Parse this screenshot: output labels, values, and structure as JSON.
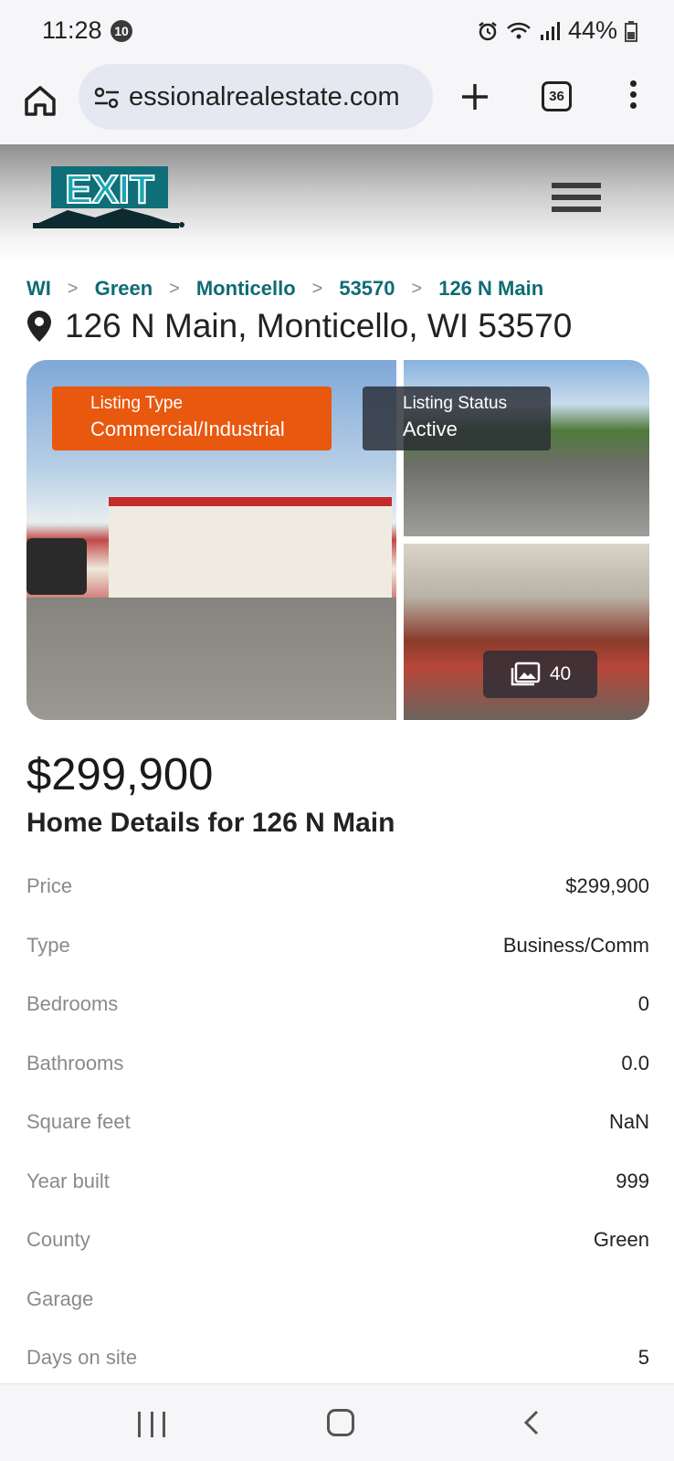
{
  "status_bar": {
    "time": "11:28",
    "notification_count": "10",
    "battery": "44%",
    "icons": [
      "alarm-icon",
      "wifi-icon",
      "signal-icon",
      "battery-icon"
    ]
  },
  "browser": {
    "url": "essionalrealestate.com",
    "tab_count": "36",
    "icons": [
      "home-icon",
      "site-settings-icon",
      "new-tab-icon",
      "tabs-icon",
      "more-icon"
    ]
  },
  "site": {
    "logo_text": "EXIT",
    "menu_icon": "hamburger-menu-icon"
  },
  "breadcrumb": [
    "WI",
    "Green",
    "Monticello",
    "53570",
    "126 N Main"
  ],
  "address": "126 N Main, Monticello, WI 53570",
  "gallery": {
    "listing_type_label": "Listing Type",
    "listing_type_value": "Commercial/Industrial",
    "listing_status_label": "Listing Status",
    "listing_status_value": "Active",
    "photo_count": "40"
  },
  "price": "$299,900",
  "details_title": "Home Details for 126 N Main",
  "details": [
    {
      "label": "Price",
      "value": "$299,900"
    },
    {
      "label": "Type",
      "value": "Business/Comm"
    },
    {
      "label": "Bedrooms",
      "value": "0"
    },
    {
      "label": "Bathrooms",
      "value": "0.0"
    },
    {
      "label": "Square feet",
      "value": "NaN"
    },
    {
      "label": "Year built",
      "value": "999"
    },
    {
      "label": "County",
      "value": "Green"
    },
    {
      "label": "Garage",
      "value": ""
    },
    {
      "label": "Days on site",
      "value": "5"
    }
  ],
  "colors": {
    "accent_teal": "#106b73",
    "listing_type_orange": "#e8580f"
  }
}
